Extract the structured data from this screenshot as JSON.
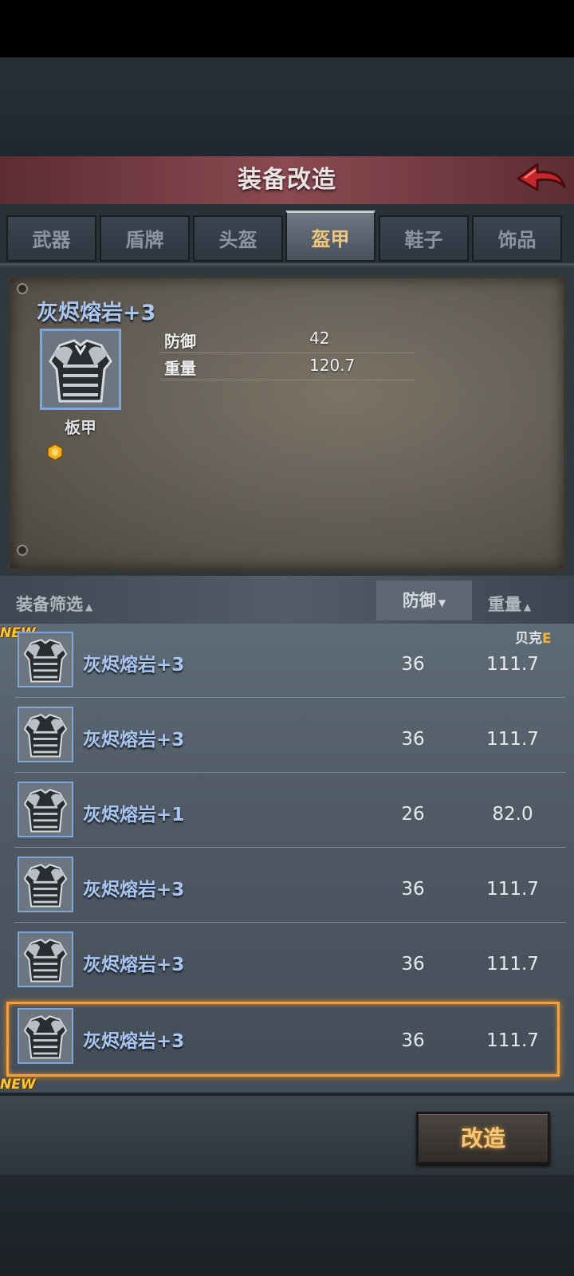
{
  "header": {
    "title": "装备改造"
  },
  "tabs": [
    {
      "label": "武器"
    },
    {
      "label": "盾牌"
    },
    {
      "label": "头盔"
    },
    {
      "label": "盔甲",
      "active": true
    },
    {
      "label": "鞋子"
    },
    {
      "label": "饰品"
    }
  ],
  "detail": {
    "name": "灰烬熔岩+3",
    "type": "板甲",
    "stats": [
      {
        "label": "防御",
        "value": "42"
      },
      {
        "label": "重量",
        "value": "120.7"
      }
    ]
  },
  "list": {
    "filter_label": "装备筛选",
    "sort_defense_label": "防御",
    "sort_weight_label": "重量",
    "player_tag_name": "贝克",
    "player_tag_suffix": "E",
    "new_badge": "NEW",
    "rows": [
      {
        "name": "灰烬熔岩+3",
        "defense": "36",
        "weight": "111.7",
        "is_new": true
      },
      {
        "name": "灰烬熔岩+3",
        "defense": "36",
        "weight": "111.7"
      },
      {
        "name": "灰烬熔岩+1",
        "defense": "26",
        "weight": "82.0"
      },
      {
        "name": "灰烬熔岩+3",
        "defense": "36",
        "weight": "111.7"
      },
      {
        "name": "灰烬熔岩+3",
        "defense": "36",
        "weight": "111.7"
      },
      {
        "name": "灰烬熔岩+3",
        "defense": "36",
        "weight": "111.7",
        "selected": true
      }
    ],
    "next_row_new_badge": "NEW"
  },
  "footer": {
    "action_label": "改造"
  },
  "colors": {
    "accent": "#f0a040",
    "item_name": "#a9c5f0",
    "new_badge": "#f5c842"
  }
}
